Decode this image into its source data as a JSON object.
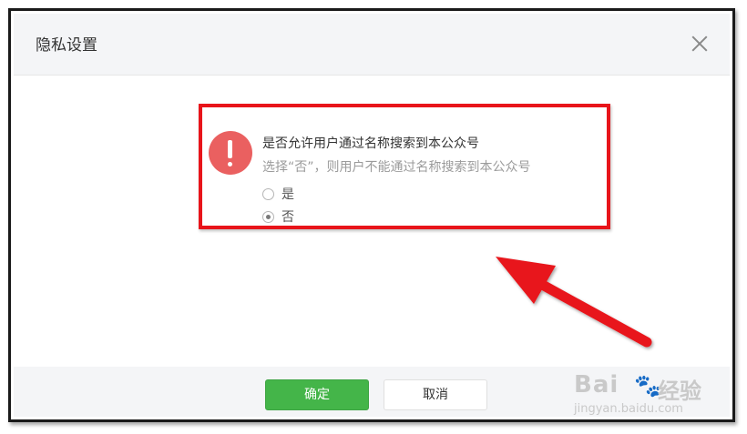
{
  "dialog": {
    "title": "隐私设置",
    "question": "是否允许用户通过名称搜索到本公众号",
    "hint": "选择“否”，则用户不能通过名称搜索到本公众号",
    "options": [
      {
        "label": "是",
        "checked": false
      },
      {
        "label": "否",
        "checked": true
      }
    ],
    "confirm_label": "确定",
    "cancel_label": "取消"
  },
  "annotation": {
    "highlight_color": "#e8141a",
    "arrow_color": "#e8141a"
  },
  "watermark": {
    "brand_left": "Bai",
    "brand_right": "经验",
    "paw_icon": "paw-icon",
    "url": "jingyan.baidu.com"
  },
  "colors": {
    "confirm_bg": "#44b549",
    "warning_icon": "#ea6060",
    "header_bg": "#f4f5f7"
  }
}
